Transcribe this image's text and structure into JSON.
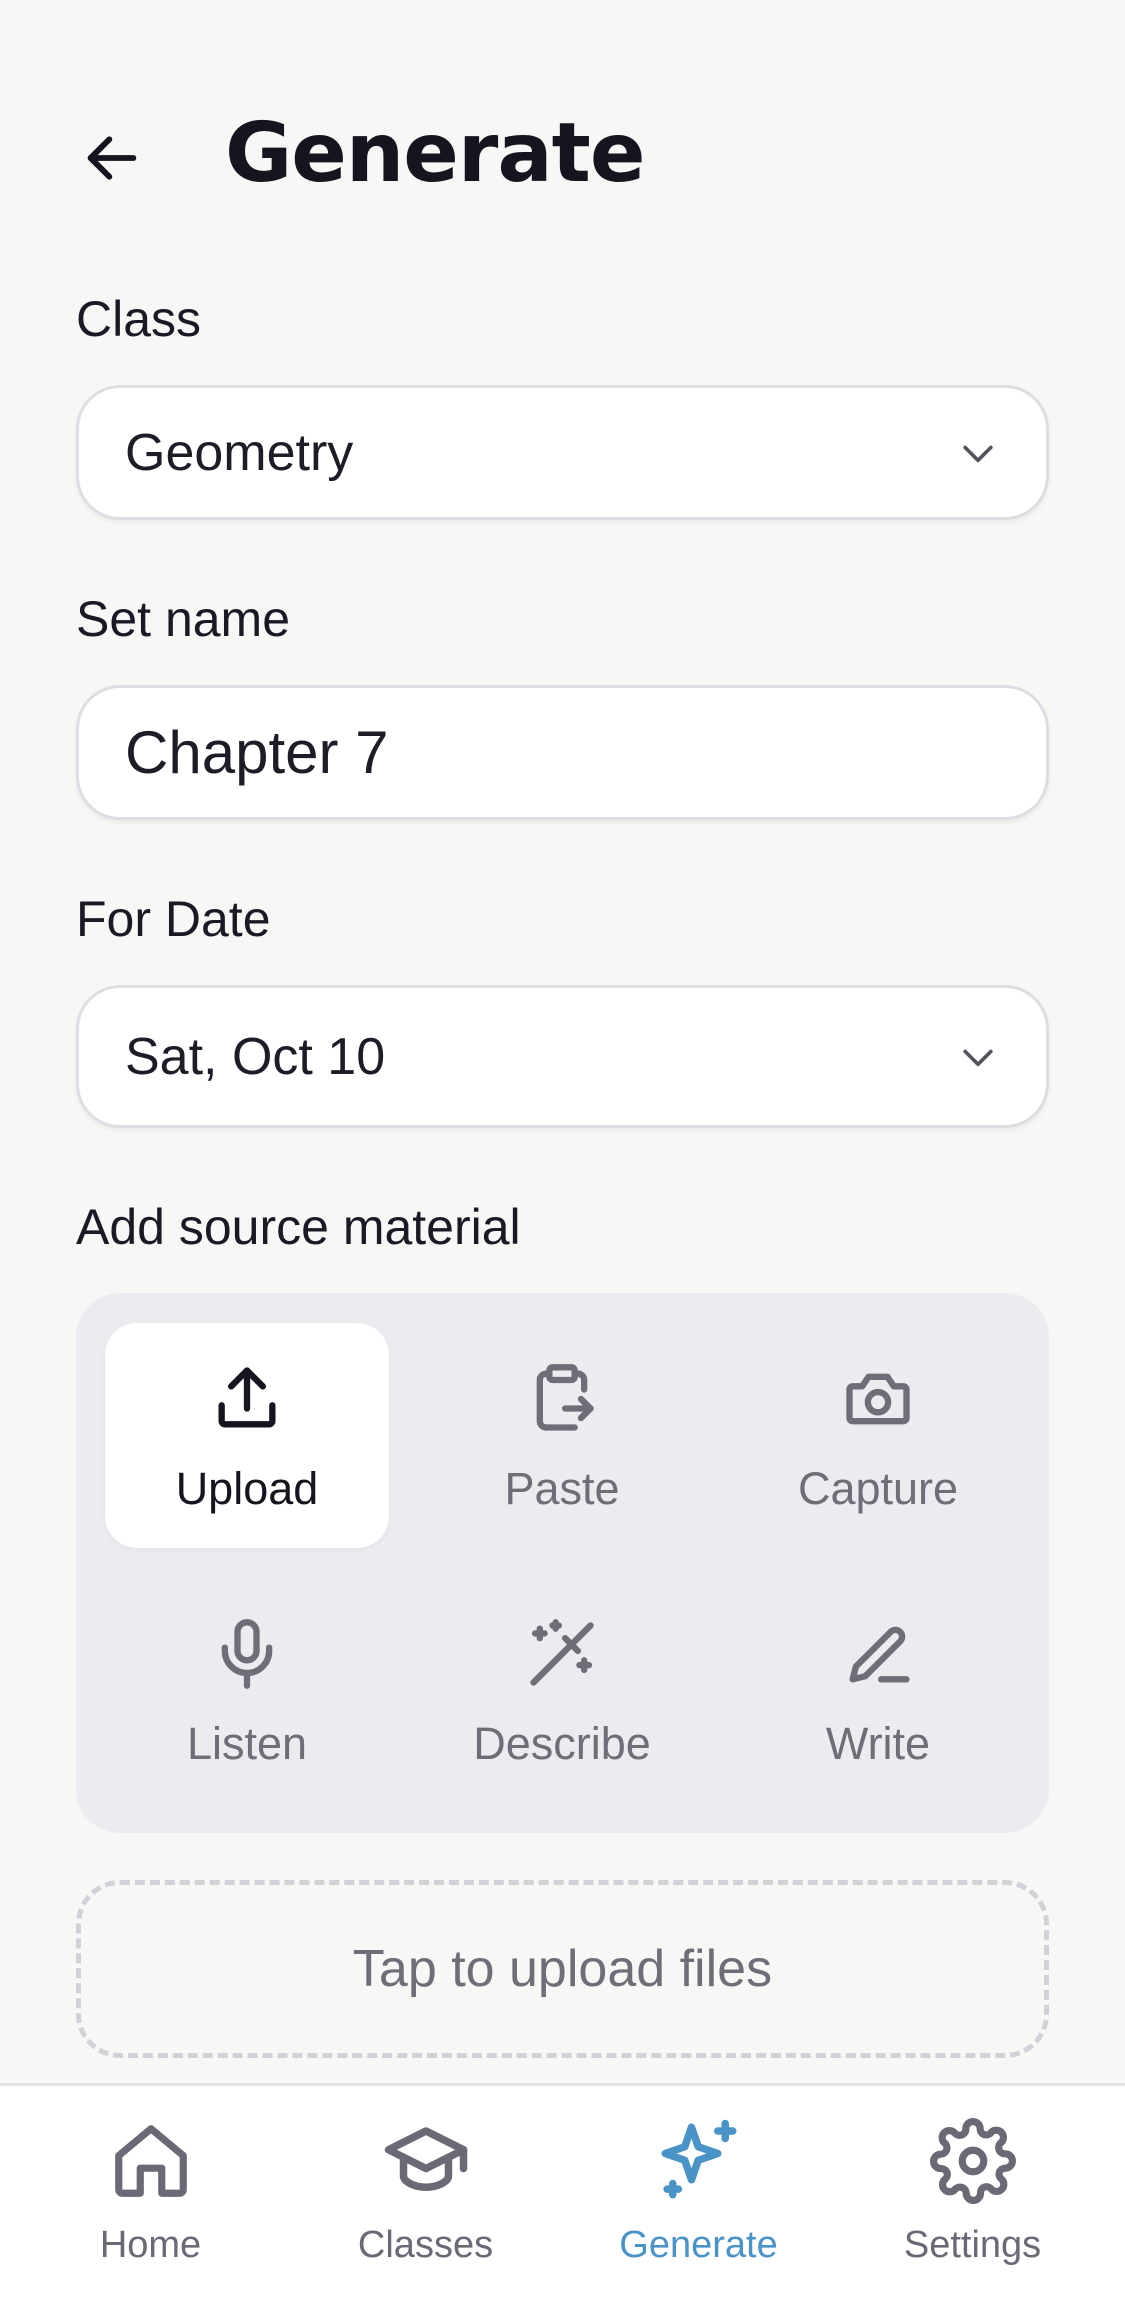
{
  "header": {
    "title": "Generate"
  },
  "form": {
    "class_label": "Class",
    "class_value": "Geometry",
    "set_name_label": "Set name",
    "set_name_value": "Chapter 7",
    "date_label": "For Date",
    "date_value": "Sat, Oct 10",
    "source_label": "Add source material"
  },
  "source_options": [
    {
      "label": "Upload",
      "icon": "upload-icon",
      "selected": true
    },
    {
      "label": "Paste",
      "icon": "clipboard-paste-icon",
      "selected": false
    },
    {
      "label": "Capture",
      "icon": "camera-icon",
      "selected": false
    },
    {
      "label": "Listen",
      "icon": "microphone-icon",
      "selected": false
    },
    {
      "label": "Describe",
      "icon": "magic-wand-icon",
      "selected": false
    },
    {
      "label": "Write",
      "icon": "pencil-icon",
      "selected": false
    }
  ],
  "drop_zone": {
    "label": "Tap to upload files"
  },
  "tabs": [
    {
      "label": "Home",
      "icon": "home-icon",
      "active": false
    },
    {
      "label": "Classes",
      "icon": "graduation-cap-icon",
      "active": false
    },
    {
      "label": "Generate",
      "icon": "sparkle-icon",
      "active": true
    },
    {
      "label": "Settings",
      "icon": "gear-icon",
      "active": false
    }
  ],
  "colors": {
    "background": "#f8f7f5",
    "panel": "#ecebf0",
    "accent": "#4a93c7",
    "muted_text": "#6e6d78"
  }
}
